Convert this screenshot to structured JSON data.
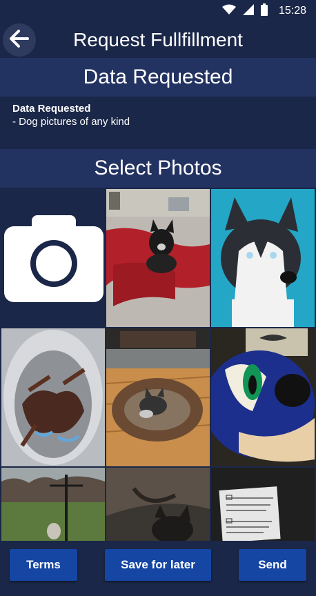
{
  "status_bar": {
    "time": "15:28",
    "icons": [
      "wifi-icon",
      "signal-icon",
      "battery-icon"
    ]
  },
  "header": {
    "title": "Request Fullfillment",
    "back_icon": "arrow-left-icon"
  },
  "data_section": {
    "heading": "Data Requested",
    "label": "Data Requested",
    "items": [
      "- Dog pictures of any kind"
    ]
  },
  "photos_section": {
    "heading": "Select Photos",
    "camera_icon": "camera-icon",
    "photos": [
      {
        "name": "dog-on-blanket-photo"
      },
      {
        "name": "husky-photo"
      },
      {
        "name": "lobsters-in-pot-photo"
      },
      {
        "name": "dog-in-bed-photo"
      },
      {
        "name": "sonic-plush-photo"
      },
      {
        "name": "yard-bird-feeder-photo"
      },
      {
        "name": "dog-closeup-photo"
      },
      {
        "name": "paper-sketch-photo"
      }
    ]
  },
  "buttons": {
    "terms": "Terms",
    "save": "Save for later",
    "send": "Send"
  },
  "colors": {
    "background": "#1b2748",
    "section": "#223261",
    "button": "#1546a3"
  }
}
